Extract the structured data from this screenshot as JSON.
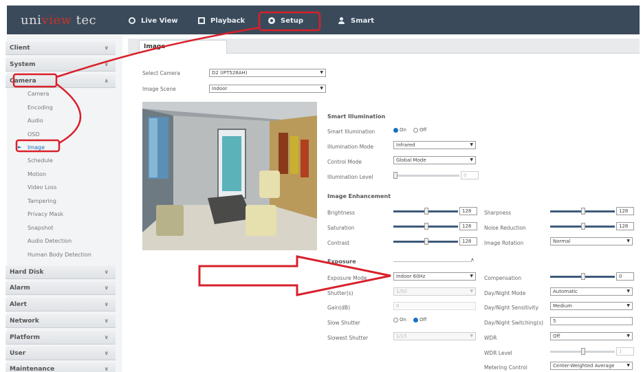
{
  "header": {
    "logo": {
      "left": "uni",
      "mid": "view",
      "right": " tec"
    },
    "nav": [
      {
        "label": "Live View",
        "icon": "eye-icon"
      },
      {
        "label": "Playback",
        "icon": "film-icon"
      },
      {
        "label": "Setup",
        "icon": "gear-icon"
      },
      {
        "label": "Smart",
        "icon": "user-icon"
      }
    ]
  },
  "sidebar": {
    "sections": [
      {
        "label": "Client"
      },
      {
        "label": "System"
      },
      {
        "label": "Camera"
      },
      {
        "label": "Hard Disk"
      },
      {
        "label": "Alarm"
      },
      {
        "label": "Alert"
      },
      {
        "label": "Network"
      },
      {
        "label": "Platform"
      },
      {
        "label": "User"
      },
      {
        "label": "Maintenance"
      }
    ],
    "camera_items": [
      "Camera",
      "Encoding",
      "Audio",
      "OSD",
      "Image",
      "Schedule",
      "Motion",
      "Video Loss",
      "Tampering",
      "Privacy Mask",
      "Snapshot",
      "Audio Detection",
      "Human Body Detection"
    ]
  },
  "tab": {
    "label": "Image"
  },
  "form": {
    "select_camera_label": "Select Camera",
    "select_camera_value": "D2 (IPT528AH)",
    "image_scene_label": "Image Scene",
    "image_scene_value": "Indoor"
  },
  "smart_illumination": {
    "title": "Smart Illumination",
    "smart_label": "Smart Illumination",
    "on": "On",
    "off": "Off",
    "mode_label": "Illumination Mode",
    "mode_value": "Infrared",
    "control_label": "Control Mode",
    "control_value": "Global Mode",
    "level_label": "Illumination Level",
    "level_value": "0"
  },
  "image_enhancement": {
    "title": "Image Enhancement",
    "brightness_label": "Brightness",
    "brightness_value": "128",
    "saturation_label": "Saturation",
    "saturation_value": "128",
    "contrast_label": "Contrast",
    "contrast_value": "128",
    "sharpness_label": "Sharpness",
    "sharpness_value": "128",
    "noise_label": "Noise Reduction",
    "noise_value": "128",
    "rotation_label": "Image Rotation",
    "rotation_value": "Normal"
  },
  "exposure": {
    "title": "Exposure",
    "mode_label": "Exposure Mode",
    "mode_value": "Indoor 60Hz",
    "shutter_label": "Shutter(s)",
    "shutter_value": "1/50",
    "gain_label": "Gain(dB)",
    "gain_value": "0",
    "slow_label": "Slow Shutter",
    "slow_on": "On",
    "slow_off": "Off",
    "slowest_label": "Slowest Shutter",
    "slowest_value": "1/15",
    "comp_label": "Compensation",
    "comp_value": "0",
    "dn_mode_label": "Day/Night Mode",
    "dn_mode_value": "Automatic",
    "dn_sens_label": "Day/Night Sensitivity",
    "dn_sens_value": "Medium",
    "dn_switch_label": "Day/Night Switching(s)",
    "dn_switch_value": "5",
    "wdr_label": "WDR",
    "wdr_value": "Off",
    "wdr_level_label": "WDR Level",
    "wdr_level_value": "1",
    "metering_label": "Metering Control",
    "metering_value": "Center-Weighted Average"
  },
  "colors": {
    "topbar": "#3b4a5a",
    "accent": "#1a6fc0",
    "annotation": "#d8202a"
  }
}
